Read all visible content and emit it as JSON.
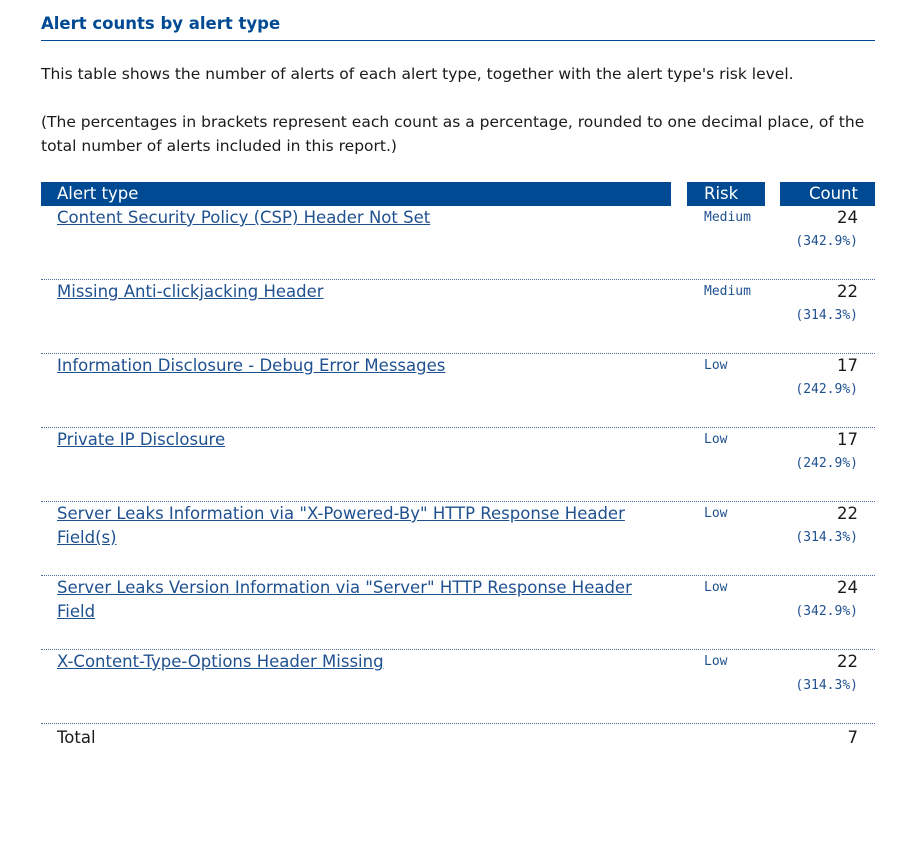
{
  "section": {
    "title": "Alert counts by alert type",
    "description": "This table shows the number of alerts of each alert type, together with the alert type's risk level.",
    "note": "(The percentages in brackets represent each count as a percentage, rounded to one decimal place, of the total number of alerts included in this report.)"
  },
  "table": {
    "headers": {
      "alert_type": "Alert type",
      "risk": "Risk",
      "count": "Count"
    },
    "rows": [
      {
        "alert_type": "Content Security Policy (CSP) Header Not Set",
        "risk": "Medium",
        "count": "24",
        "percent": "(342.9%)"
      },
      {
        "alert_type": "Missing Anti-clickjacking Header",
        "risk": "Medium",
        "count": "22",
        "percent": "(314.3%)"
      },
      {
        "alert_type": "Information Disclosure - Debug Error Messages",
        "risk": "Low",
        "count": "17",
        "percent": "(242.9%)"
      },
      {
        "alert_type": "Private IP Disclosure",
        "risk": "Low",
        "count": "17",
        "percent": "(242.9%)"
      },
      {
        "alert_type": "Server Leaks Information via \"X-Powered-By\" HTTP Response Header Field(s)",
        "risk": "Low",
        "count": "22",
        "percent": "(314.3%)"
      },
      {
        "alert_type": "Server Leaks Version Information via \"Server\" HTTP Response Header Field",
        "risk": "Low",
        "count": "24",
        "percent": "(342.9%)"
      },
      {
        "alert_type": "X-Content-Type-Options Header Missing",
        "risk": "Low",
        "count": "22",
        "percent": "(314.3%)"
      }
    ],
    "total": {
      "label": "Total",
      "value": "7"
    }
  },
  "colors": {
    "header_bg": "#004a93",
    "link": "#1f5190",
    "title": "#004a93"
  }
}
